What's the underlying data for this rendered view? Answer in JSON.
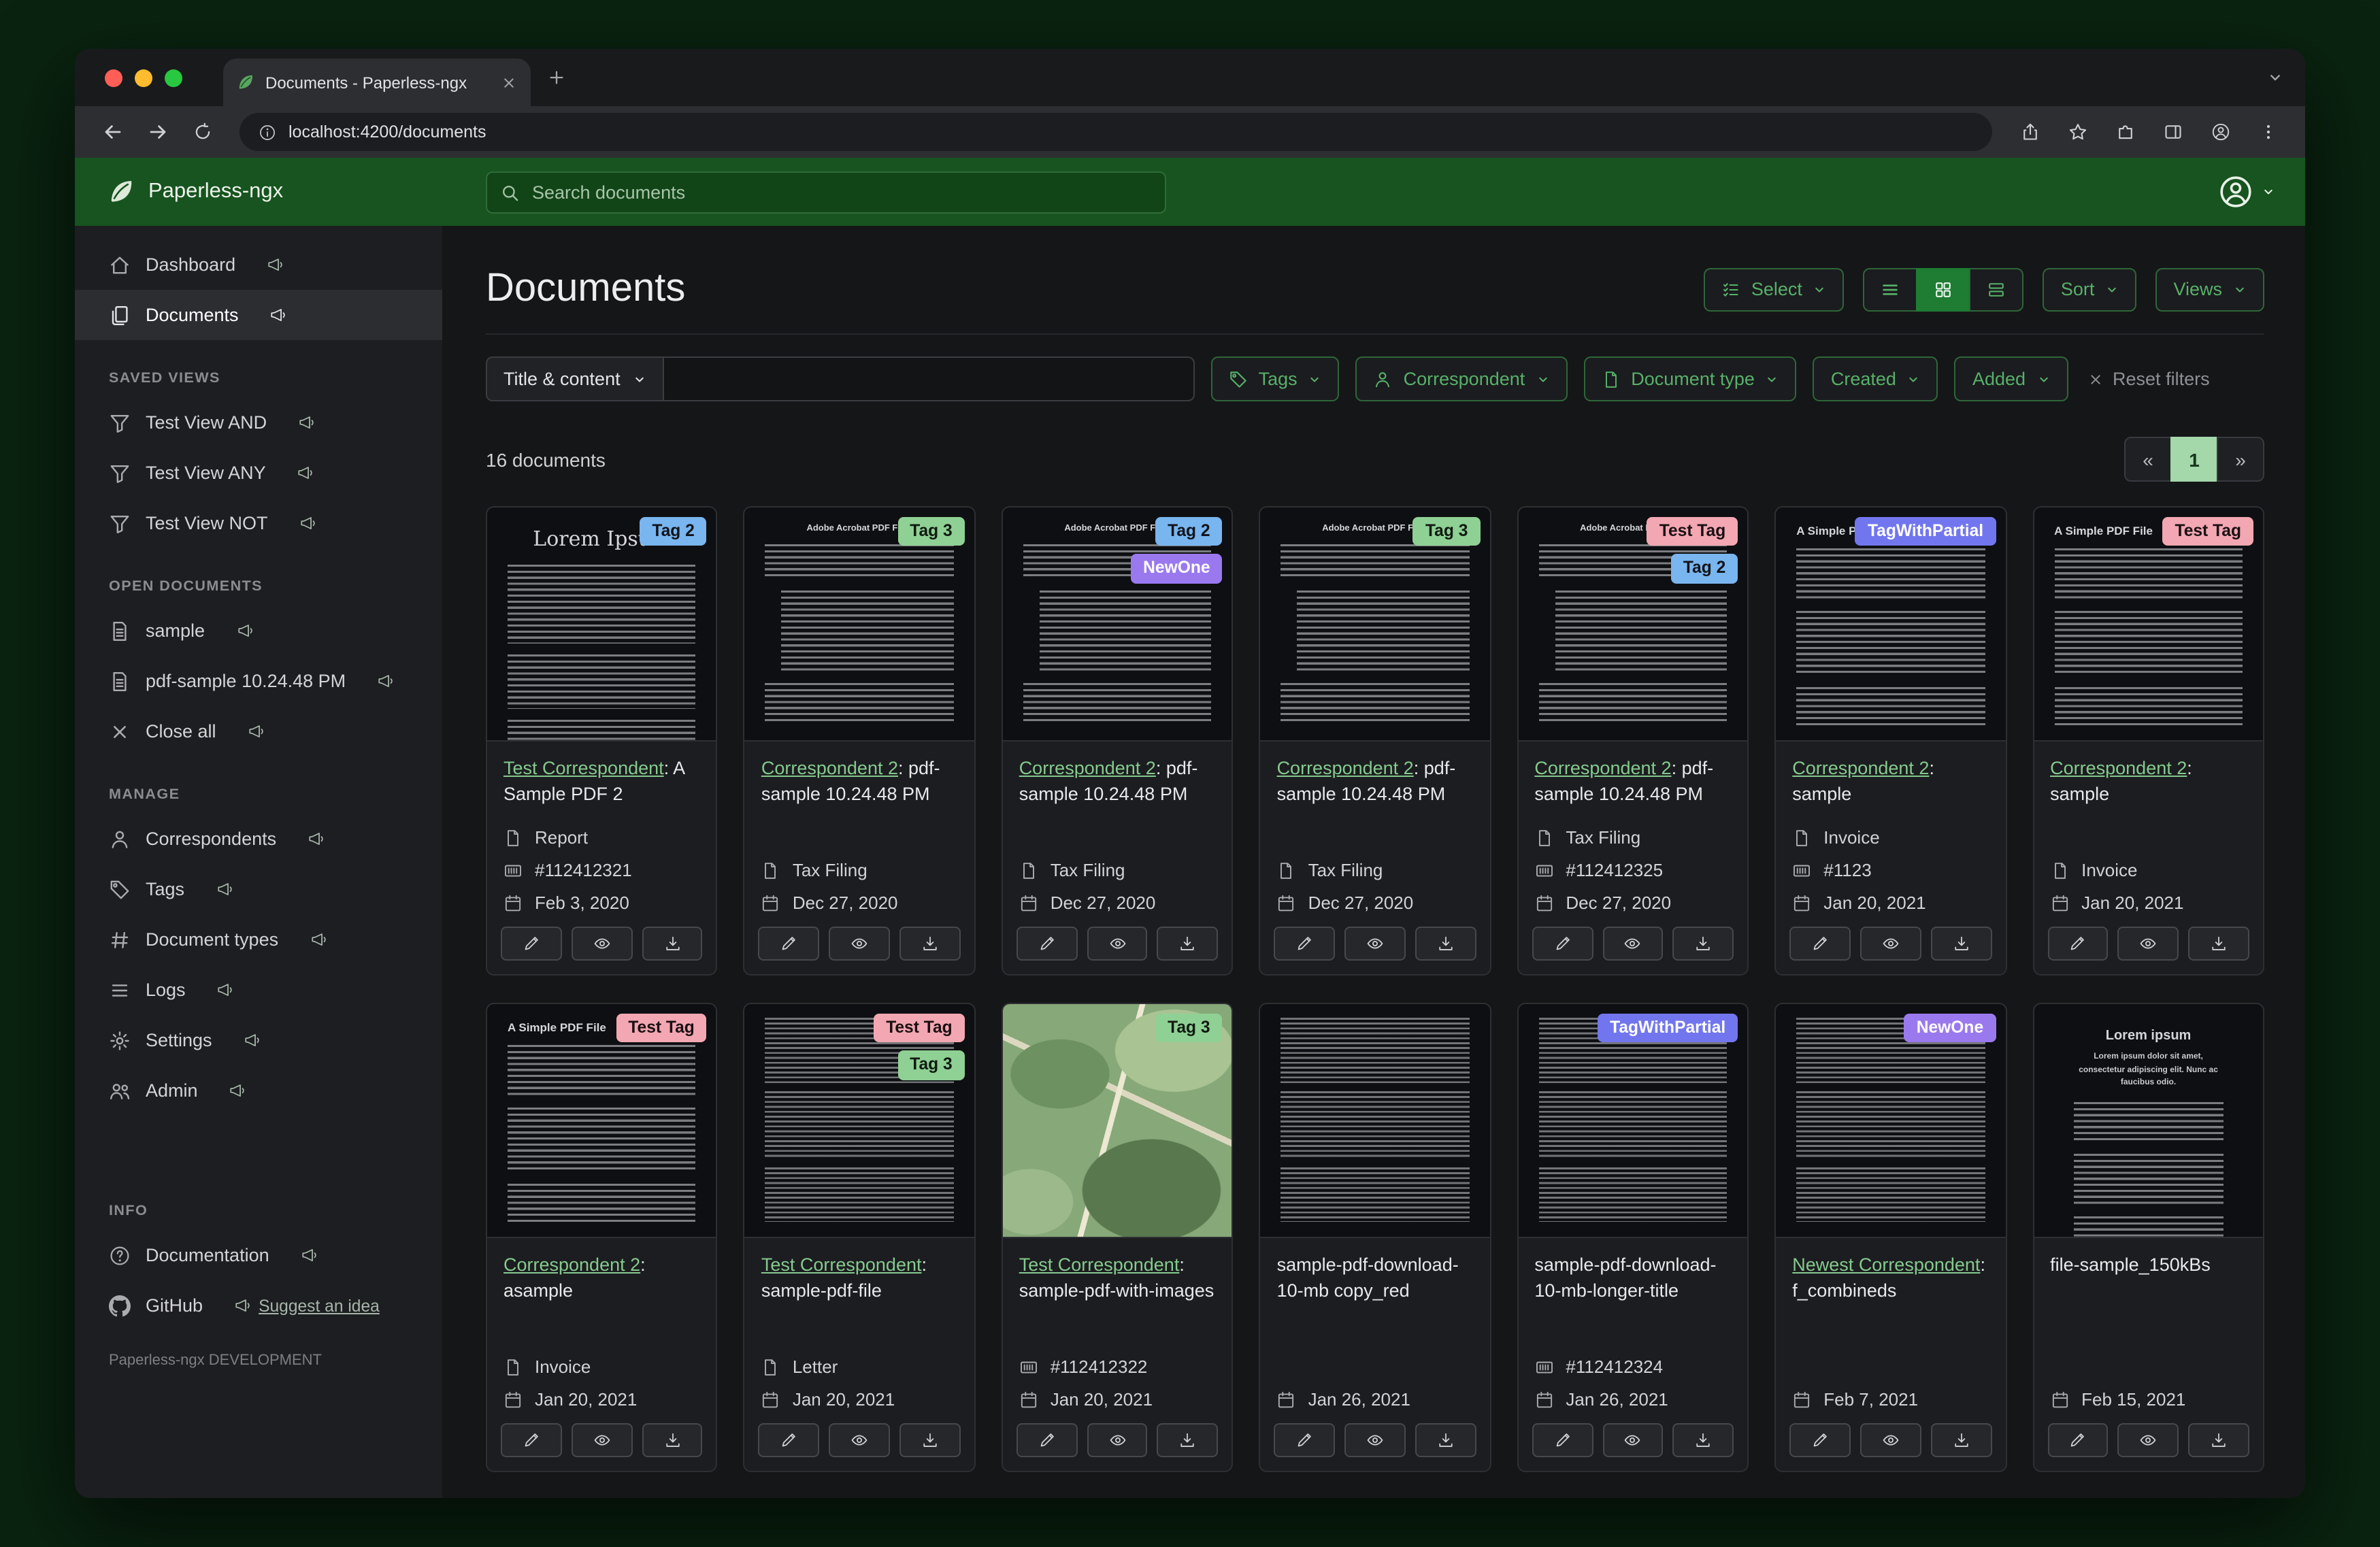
{
  "browser": {
    "tab_title": "Documents - Paperless-ngx",
    "url": "localhost:4200/documents"
  },
  "header": {
    "brand": "Paperless-ngx",
    "search_placeholder": "Search documents"
  },
  "sidebar": {
    "groups": [
      {
        "heading": null,
        "items": [
          {
            "label": "Dashboard",
            "icon": "home"
          },
          {
            "label": "Documents",
            "icon": "docs",
            "active": true
          }
        ]
      },
      {
        "heading": "SAVED VIEWS",
        "items": [
          {
            "label": "Test View AND",
            "icon": "funnel"
          },
          {
            "label": "Test View ANY",
            "icon": "funnel"
          },
          {
            "label": "Test View NOT",
            "icon": "funnel"
          }
        ]
      },
      {
        "heading": "OPEN DOCUMENTS",
        "items": [
          {
            "label": "sample",
            "icon": "filetext"
          },
          {
            "label": "pdf-sample 10.24.48 PM",
            "icon": "filetext"
          },
          {
            "label": "Close all",
            "icon": "x"
          }
        ]
      },
      {
        "heading": "MANAGE",
        "items": [
          {
            "label": "Correspondents",
            "icon": "person"
          },
          {
            "label": "Tags",
            "icon": "tag"
          },
          {
            "label": "Document types",
            "icon": "hash"
          },
          {
            "label": "Logs",
            "icon": "list"
          },
          {
            "label": "Settings",
            "icon": "gear"
          },
          {
            "label": "Admin",
            "icon": "people"
          }
        ]
      },
      {
        "heading": "INFO",
        "gap": true,
        "items": [
          {
            "label": "Documentation",
            "icon": "question"
          },
          {
            "label": "GitHub",
            "icon": "github",
            "extra": {
              "label": "Suggest an idea",
              "icon": "megaphone"
            }
          }
        ]
      }
    ],
    "footer": "Paperless-ngx DEVELOPMENT"
  },
  "main": {
    "title": "Documents",
    "toolbar": {
      "select_label": "Select",
      "sort_label": "Sort",
      "views_label": "Views"
    },
    "filterbar": {
      "field_label": "Title & content",
      "tags_label": "Tags",
      "correspondent_label": "Correspondent",
      "document_type_label": "Document type",
      "created_label": "Created",
      "added_label": "Added",
      "reset_label": "Reset filters"
    },
    "count_text": "16 documents",
    "pagination": {
      "prev": "«",
      "current": "1",
      "next": "»"
    }
  },
  "tag_styles": {
    "Tag 2": {
      "bg": "#79b5ef",
      "fg": "#10141a"
    },
    "Tag 3": {
      "bg": "#8fd094",
      "fg": "#0f1a10"
    },
    "NewOne": {
      "bg": "#9a79ef",
      "fg": "#ffffff"
    },
    "Test Tag": {
      "bg": "#f3a7b2",
      "fg": "#1a1013"
    },
    "TagWithPartial": {
      "bg": "#7276ee",
      "fg": "#ffffff"
    }
  },
  "cards": [
    {
      "tags": [
        "Tag 2"
      ],
      "title_link": "Test Correspondent",
      "title_rest": ": A Sample PDF 2",
      "meta": [
        {
          "icon": "doctype",
          "text": "Report"
        },
        {
          "icon": "asn",
          "text": "#112412321"
        },
        {
          "icon": "calendar",
          "text": "Feb 3, 2020"
        }
      ],
      "thumb": {
        "variant": "serif",
        "heading": "Lorem Ipsum"
      }
    },
    {
      "tags": [
        "Tag 3"
      ],
      "title_link": "Correspondent 2",
      "title_rest": ": pdf-sample 10.24.48 PM",
      "meta": [
        {
          "icon": "doctype",
          "text": "Tax Filing"
        },
        {
          "icon": "calendar",
          "text": "Dec 27, 2020"
        }
      ],
      "thumb": {
        "variant": "acrobat",
        "heading": "Adobe Acrobat PDF Files"
      }
    },
    {
      "tags": [
        "Tag 2",
        "NewOne"
      ],
      "title_link": "Correspondent 2",
      "title_rest": ": pdf-sample 10.24.48 PM",
      "meta": [
        {
          "icon": "doctype",
          "text": "Tax Filing"
        },
        {
          "icon": "calendar",
          "text": "Dec 27, 2020"
        }
      ],
      "thumb": {
        "variant": "acrobat",
        "heading": "Adobe Acrobat PDF Files"
      }
    },
    {
      "tags": [
        "Tag 3"
      ],
      "title_link": "Correspondent 2",
      "title_rest": ": pdf-sample 10.24.48 PM",
      "meta": [
        {
          "icon": "doctype",
          "text": "Tax Filing"
        },
        {
          "icon": "calendar",
          "text": "Dec 27, 2020"
        }
      ],
      "thumb": {
        "variant": "acrobat",
        "heading": "Adobe Acrobat PDF Files"
      }
    },
    {
      "tags": [
        "Test Tag",
        "Tag 2"
      ],
      "title_link": "Correspondent 2",
      "title_rest": ": pdf-sample 10.24.48 PM",
      "meta": [
        {
          "icon": "doctype",
          "text": "Tax Filing"
        },
        {
          "icon": "asn",
          "text": "#112412325"
        },
        {
          "icon": "calendar",
          "text": "Dec 27, 2020"
        }
      ],
      "thumb": {
        "variant": "acrobat",
        "heading": "Adobe Acrobat PDF Files"
      }
    },
    {
      "tags": [
        "TagWithPartial"
      ],
      "title_link": "Correspondent 2",
      "title_rest": ": sample",
      "meta": [
        {
          "icon": "doctype",
          "text": "Invoice"
        },
        {
          "icon": "asn",
          "text": "#1123"
        },
        {
          "icon": "calendar",
          "text": "Jan 20, 2021"
        }
      ],
      "thumb": {
        "variant": "simple",
        "heading": "A Simple PDF File"
      }
    },
    {
      "tags": [
        "Test Tag"
      ],
      "title_link": "Correspondent 2",
      "title_rest": ": sample",
      "meta": [
        {
          "icon": "doctype",
          "text": "Invoice"
        },
        {
          "icon": "calendar",
          "text": "Jan 20, 2021"
        }
      ],
      "thumb": {
        "variant": "simple",
        "heading": "A Simple PDF File"
      }
    },
    {
      "tags": [
        "Test Tag"
      ],
      "title_link": "Correspondent 2",
      "title_rest": ": asample",
      "meta": [
        {
          "icon": "doctype",
          "text": "Invoice"
        },
        {
          "icon": "calendar",
          "text": "Jan 20, 2021"
        }
      ],
      "thumb": {
        "variant": "simple",
        "heading": "A Simple PDF File"
      }
    },
    {
      "tags": [
        "Test Tag",
        "Tag 3"
      ],
      "title_link": "Test Correspondent",
      "title_rest": ": sample-pdf-file",
      "meta": [
        {
          "icon": "doctype",
          "text": "Letter"
        },
        {
          "icon": "calendar",
          "text": "Jan 20, 2021"
        }
      ],
      "thumb": {
        "variant": "dense",
        "heading": ""
      }
    },
    {
      "tags": [
        "Tag 3"
      ],
      "title_link": "Test Correspondent",
      "title_rest": ": sample-pdf-with-images",
      "meta": [
        {
          "icon": "asn",
          "text": "#112412322"
        },
        {
          "icon": "calendar",
          "text": "Jan 20, 2021"
        }
      ],
      "thumb": {
        "variant": "map",
        "heading": ""
      }
    },
    {
      "tags": [],
      "title_link": null,
      "title_rest": "sample-pdf-download-10-mb copy_red",
      "meta": [
        {
          "icon": "calendar",
          "text": "Jan 26, 2021"
        }
      ],
      "thumb": {
        "variant": "dense",
        "heading": ""
      }
    },
    {
      "tags": [
        "TagWithPartial"
      ],
      "title_link": null,
      "title_rest": "sample-pdf-download-10-mb-longer-title",
      "meta": [
        {
          "icon": "asn",
          "text": "#112412324"
        },
        {
          "icon": "calendar",
          "text": "Jan 26, 2021"
        }
      ],
      "thumb": {
        "variant": "dense",
        "heading": ""
      }
    },
    {
      "tags": [
        "NewOne"
      ],
      "title_link": "Newest Correspondent",
      "title_rest": ": f_combineds",
      "meta": [
        {
          "icon": "calendar",
          "text": "Feb 7, 2021"
        }
      ],
      "thumb": {
        "variant": "dense",
        "heading": ""
      }
    },
    {
      "tags": [],
      "title_link": null,
      "title_rest": "file-sample_150kBs",
      "meta": [
        {
          "icon": "calendar",
          "text": "Feb 15, 2021"
        }
      ],
      "thumb": {
        "variant": "center",
        "heading": "Lorem ipsum",
        "sub": "Lorem ipsum dolor sit amet, consectetur adipiscing elit. Nunc ac faucibus odio."
      }
    }
  ]
}
